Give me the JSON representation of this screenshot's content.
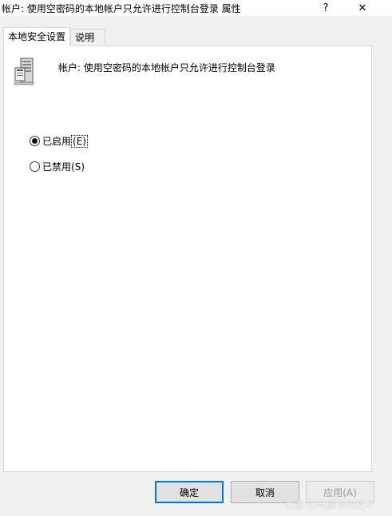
{
  "window": {
    "title": "帐户: 使用空密码的本地帐户只允许进行控制台登录 属性",
    "help_label": "?",
    "close_label": "✕"
  },
  "tabs": [
    {
      "label": "本地安全设置",
      "active": true
    },
    {
      "label": "说明",
      "active": false
    }
  ],
  "panel": {
    "icon": "server-icon",
    "policy_title": "帐户: 使用空密码的本地帐户只允许进行控制台登录",
    "options": [
      {
        "text": "已启用",
        "mnemonic": "(E)",
        "checked": true
      },
      {
        "text": "已禁用",
        "mnemonic": "(S)",
        "checked": false
      }
    ]
  },
  "buttons": {
    "ok": "确定",
    "cancel": "取消",
    "apply": "应用(A)"
  },
  "watermark": "百家号/电脑系统技术"
}
